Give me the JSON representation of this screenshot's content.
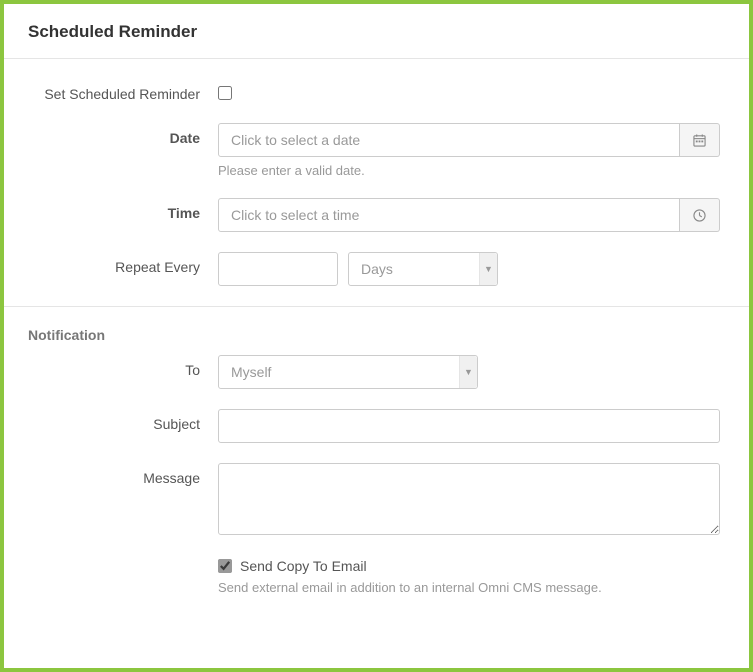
{
  "panel": {
    "title": "Scheduled Reminder"
  },
  "scheduled": {
    "set_label": "Set Scheduled Reminder",
    "date_label": "Date",
    "date_placeholder": "Click to select a date",
    "date_help": "Please enter a valid date.",
    "time_label": "Time",
    "time_placeholder": "Click to select a time",
    "repeat_label": "Repeat Every",
    "repeat_unit": "Days"
  },
  "notification": {
    "section_title": "Notification",
    "to_label": "To",
    "to_value": "Myself",
    "subject_label": "Subject",
    "message_label": "Message",
    "send_copy_label": "Send Copy To Email",
    "send_copy_help": "Send external email in addition to an internal Omni CMS message."
  }
}
